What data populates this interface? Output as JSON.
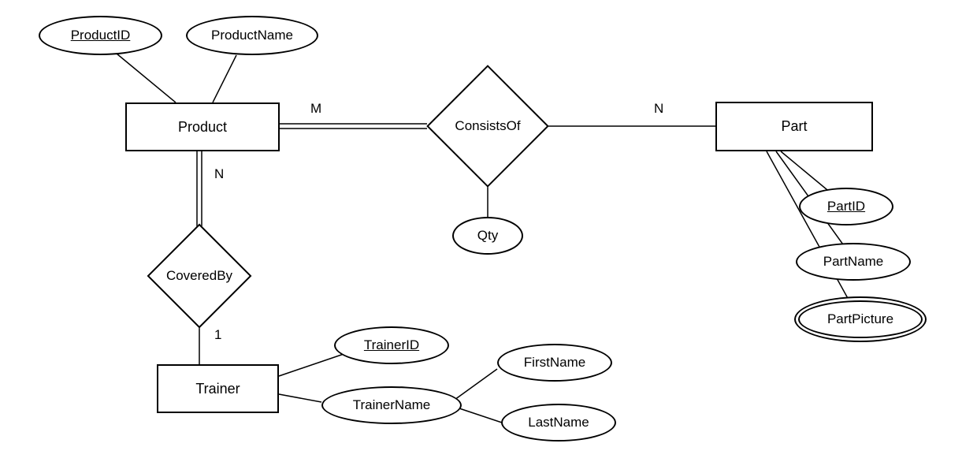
{
  "entities": {
    "product": "Product",
    "part": "Part",
    "trainer": "Trainer"
  },
  "relationships": {
    "consistsOf": "ConsistsOf",
    "coveredBy": "CoveredBy"
  },
  "attributes": {
    "productID": "ProductID",
    "productName": "ProductName",
    "qty": "Qty",
    "partID": "PartID",
    "partName": "PartName",
    "partPicture": "PartPicture",
    "trainerID": "TrainerID",
    "trainerName": "TrainerName",
    "firstName": "FirstName",
    "lastName": "LastName"
  },
  "cardinalities": {
    "productConsists": "M",
    "partConsists": "N",
    "productCovered": "N",
    "trainerCovered": "1"
  }
}
